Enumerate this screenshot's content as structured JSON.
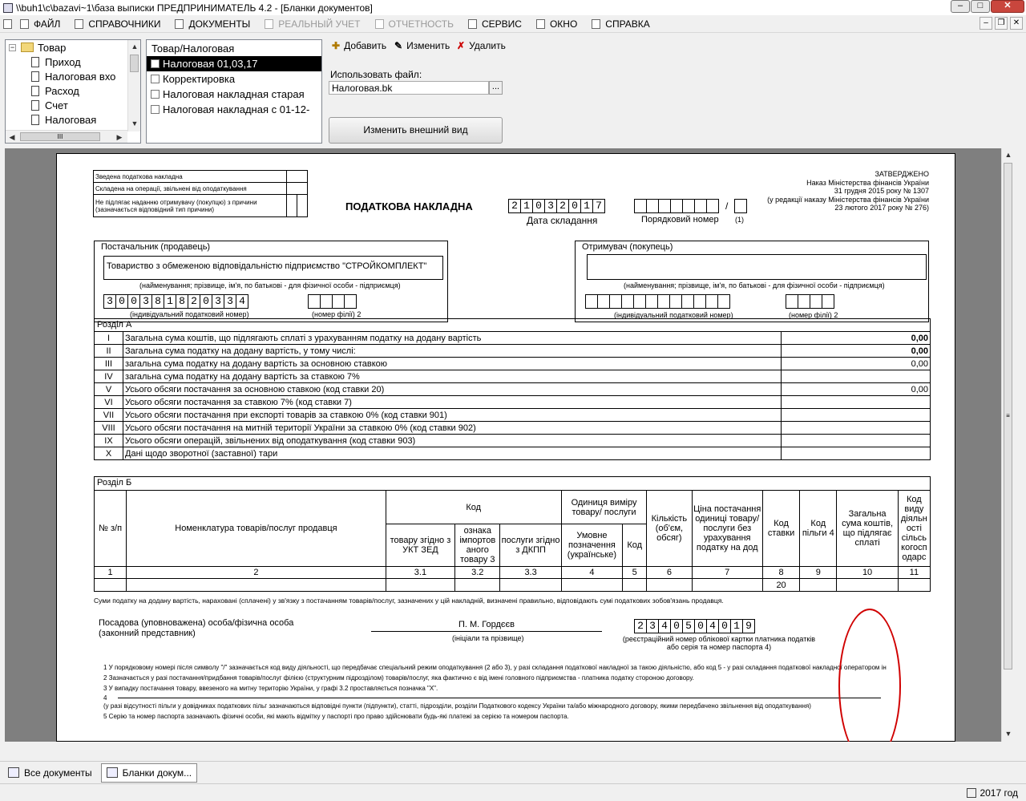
{
  "window": {
    "title": "\\\\buh1\\c\\bazavi~1\\база выписки  ПРЕДПРИНИМАТЕЛЬ 4.2 - [Бланки документов]"
  },
  "menu": [
    {
      "label": "ФАЙЛ",
      "enabled": true
    },
    {
      "label": "СПРАВОЧНИКИ",
      "enabled": true
    },
    {
      "label": "ДОКУМЕНТЫ",
      "enabled": true
    },
    {
      "label": "РЕАЛЬНЫЙ УЧЕТ",
      "enabled": false
    },
    {
      "label": "ОТЧЕТНОСТЬ",
      "enabled": false
    },
    {
      "label": "СЕРВИС",
      "enabled": true
    },
    {
      "label": "ОКНО",
      "enabled": true
    },
    {
      "label": "СПРАВКА",
      "enabled": true
    }
  ],
  "tree": {
    "root": "Товар",
    "items": [
      "Приход",
      "Налоговая вхо",
      "Расход",
      "Счет",
      "Налоговая"
    ]
  },
  "list": {
    "header": "Товар/Налоговая",
    "items": [
      "Налоговая 01,03,17",
      "Корректировка",
      "Налоговая накладная старая",
      "Налоговая накладная с 01-12-"
    ],
    "selected": 0
  },
  "toolbar": {
    "add": "Добавить",
    "edit": "Изменить",
    "delete": "Удалить"
  },
  "file": {
    "label": "Использовать файл:",
    "value": "Налоговая.bk",
    "browse": "...",
    "change_view": "Изменить внешний вид"
  },
  "form": {
    "topleft": [
      "Зведена податкова накладна",
      "Складена на операції, звільнені від оподаткування",
      "Не підлягає наданню отримувачу (покупцю) з причини (зазначається відповідний тип причини)"
    ],
    "title": "ПОДАТКОВА НАКЛАДНА",
    "date_digits": [
      "2",
      "1",
      "0",
      "3",
      "2",
      "0",
      "1",
      "7"
    ],
    "date_label": "Дата складання",
    "seq_label": "Порядковий номер",
    "seq_note": "(1)",
    "approved": [
      "ЗАТВЕРДЖЕНО",
      "Наказ Міністерства фінансів України",
      "31 грудня 2015 року № 1307",
      "(у редакції наказу Міністерства фінансів України",
      "23 лютого 2017 року № 276)"
    ],
    "supplier_title": "Постачальник (продавець)",
    "supplier_name": "Товариство з обмеженою відповідальністю підприємство \"СТРОЙКОМПЛЕКТ\"",
    "name_caption": "(найменування; прізвище, ім'я, по батькові - для фізичної особи - підприємця)",
    "supplier_ipn": [
      "3",
      "0",
      "0",
      "3",
      "8",
      "1",
      "8",
      "2",
      "0",
      "3",
      "3",
      "4"
    ],
    "ipn_caption": "(індивідуальний податковий номер)",
    "branch_caption": "(номер філії)  2",
    "buyer_title": "Отримувач (покупець)",
    "secA_title": "Розділ А",
    "secA_rows": [
      {
        "n": "I",
        "text": "Загальна сума коштів, що підлягають сплаті з урахуванням податку на додану вартість",
        "value": "0,00",
        "bold": true
      },
      {
        "n": "II",
        "text": "Загальна сума податку на додану вартість, у тому числі:",
        "value": "0,00",
        "bold": true
      },
      {
        "n": "III",
        "text": "загальна сума податку на додану вартість за основною ставкою",
        "value": "0,00",
        "bold": false
      },
      {
        "n": "IV",
        "text": "загальна сума податку на додану вартість за  ставкою 7%",
        "value": "",
        "bold": false
      },
      {
        "n": "V",
        "text": "Усього обсяги постачання за основною ставкою (код ставки 20)",
        "value": "0,00",
        "bold": false
      },
      {
        "n": "VI",
        "text": "Усього обсяги постачання за ставкою 7% (код ставки 7)",
        "value": "",
        "bold": false
      },
      {
        "n": "VII",
        "text": "Усього обсяги постачання при експорті товарів за ставкою 0% (код ставки 901)",
        "value": "",
        "bold": false
      },
      {
        "n": "VIII",
        "text": "Усього обсяги постачання на митній території України за ставкою 0% (код ставки 902)",
        "value": "",
        "bold": false
      },
      {
        "n": "IX",
        "text": "Усього обсяги операцій, звільнених від оподаткування (код ставки 903)",
        "value": "",
        "bold": false
      },
      {
        "n": "X",
        "text": "Дані щодо зворотної (заставної) тари",
        "value": "",
        "bold": false
      }
    ],
    "secB_title": "Розділ Б",
    "secB_headers": {
      "num": "№ з/п",
      "nomenclature": "Номенклатура товарів/послуг продавця",
      "code": "Код",
      "ukt": "товару згідно з УКТ ЗЕД",
      "import": "ознака імпортов аного товару 3",
      "dkpp": "послуги згідно з ДКПП",
      "unit": "Одиниця виміру товару/ послуги",
      "unit_name": "Умовне позначення (українське)",
      "unit_code": "Код",
      "qty": "Кількість (об'єм, обсяг)",
      "price": "Ціна постачання одиниці товару/ послуги без урахування податку на дод",
      "rate": "Код ставки",
      "benefit": "Код пільги 4",
      "total": "Загальна сума коштів, що підлягає сплаті",
      "activity": "Код виду діяльн ості сільсь когосп одарс"
    },
    "secB_colnums": [
      "1",
      "2",
      "3.1",
      "3.2",
      "3.3",
      "4",
      "5",
      "6",
      "7",
      "8",
      "9",
      "10",
      "11"
    ],
    "secB_datarow": [
      "",
      "",
      "",
      "",
      "",
      "",
      "",
      "",
      "",
      "20",
      "",
      "",
      ""
    ],
    "statement": "Суми податку на додану вартість, нараховані (сплачені) у зв'язку з  постачанням товарів/послуг, зазначених у цій накладній, визначені правильно, відповідають сумі податкових зобов'язань продавця.",
    "person_label": "Посадова  (уповноважена)  особа/фізична особа (законний представник)",
    "signer": "П. М. Гордєєв",
    "signer_caption": "(ініціали та прізвище)",
    "reg_digits": [
      "2",
      "3",
      "4",
      "0",
      "5",
      "0",
      "4",
      "0",
      "1",
      "9"
    ],
    "reg_caption": "(реєстраційний номер облікової картки платника податків або серія та номер паспорта 4)",
    "notes": [
      "1       У порядковому номері після символу \"/\" зазначається код виду діяльності, що передбачає спеціальний режим оподаткування (2 або 3), у разі складання податкової накладної за такою діяльністю, або код 5 - у разі складання податкової накладної оператором ін",
      "2       Зазначається у разі постачання/придбання товарів/послуг філією (структурним підрозділом) товарів/послуг, яка фактично є від імені головного підприємства - платника податку стороною договору.",
      "3       У випадку постачання товару, ввезеного на митну територію України, у графі 3.2 проставляється позначка \"Х\".",
      "4",
      "                      (у разі відсутності пільги у довідниках податкових пільг зазначаються відповідні пункти (підпункти), статті, підрозділи, розділи Податкового кодексу України та/або міжнародного договору, якими передбачено звільнення від оподаткування)",
      "5       Серію та номер паспорта зазначають фізичні особи, які мають відмітку у паспорті про право здійснювати будь-які платежі за серією та номером паспорта."
    ]
  },
  "tasks": [
    {
      "label": "Все документы",
      "active": false
    },
    {
      "label": "Бланки докум...",
      "active": true
    }
  ],
  "status": {
    "year": "2017 год"
  }
}
